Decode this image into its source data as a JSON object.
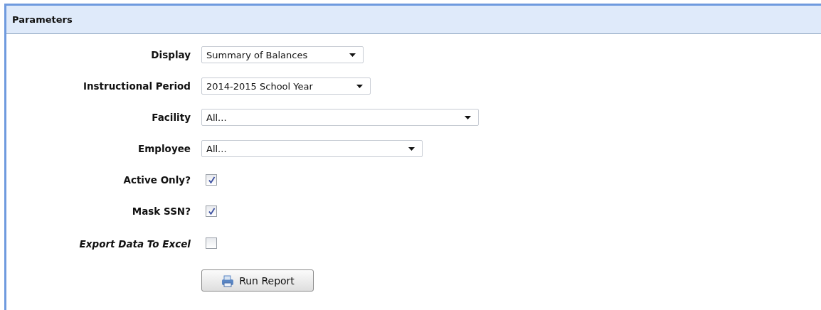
{
  "panel": {
    "title": "Parameters"
  },
  "fields": [
    {
      "kind": "select",
      "label": "Display",
      "value": "Summary of Balances"
    },
    {
      "kind": "select",
      "label": "Instructional Period",
      "value": "2014-2015 School Year"
    },
    {
      "kind": "select",
      "label": "Facility",
      "value": "All..."
    },
    {
      "kind": "select",
      "label": "Employee",
      "value": "All..."
    },
    {
      "kind": "checkbox",
      "label": "Active Only?",
      "checked": true
    },
    {
      "kind": "checkbox",
      "label": "Mask SSN?",
      "checked": true
    },
    {
      "kind": "checkbox",
      "label": "Export Data To Excel",
      "checked": false,
      "italic": true
    }
  ],
  "run_button": {
    "label": "Run Report"
  }
}
